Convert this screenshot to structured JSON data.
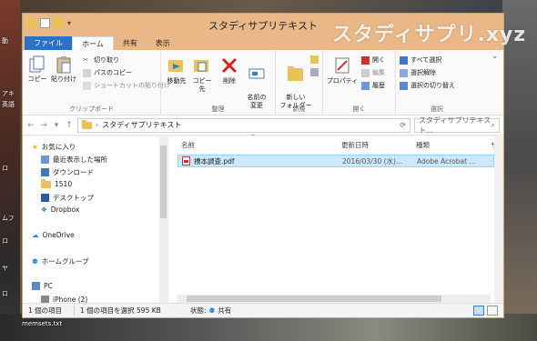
{
  "desktop": {
    "left_labels": [
      "動",
      "アキ",
      "英語",
      "ロ",
      "ムフ",
      "ロ",
      "ヤ",
      "ロ"
    ],
    "bottom_label": "memsets.txt"
  },
  "watermark": "スタディサプリ.xyz",
  "window": {
    "title": "スタディサプリテキスト"
  },
  "tabs": [
    {
      "label": "ファイル"
    },
    {
      "label": "ホーム"
    },
    {
      "label": "共有"
    },
    {
      "label": "表示"
    }
  ],
  "ribbon": {
    "clipboard": {
      "label": "クリップボード",
      "copy": "コピー",
      "paste": "貼り付け",
      "cut": "切り取り",
      "copy_path": "パスのコピー",
      "paste_shortcut": "ショートカットの貼り付け"
    },
    "organize": {
      "label": "整理",
      "move_to": "移動先",
      "copy_to": "コピー先",
      "delete": "削除",
      "rename": "名前の\n変更"
    },
    "new": {
      "label": "新規",
      "new_folder": "新しい\nフォルダー"
    },
    "open": {
      "label": "開く",
      "properties": "プロパティ",
      "open": "開く",
      "edit": "編集",
      "history": "履歴"
    },
    "select": {
      "label": "選択",
      "select_all": "すべて選択",
      "select_none": "選択解除",
      "invert": "選択の切り替え"
    }
  },
  "address": {
    "path": "スタディサプリテキスト",
    "search_placeholder": "スタディサプリテキスト..."
  },
  "nav_pane": {
    "favorites": "お気に入り",
    "items": [
      "最近表示した場所",
      "ダウンロード",
      "1510",
      "デスクトップ",
      "Dropbox"
    ],
    "onedrive": "OneDrive",
    "homegroup": "ホームグループ",
    "pc": "PC",
    "pc_child": "iPhone (2)"
  },
  "columns": {
    "name": "名前",
    "date": "更新日時",
    "type": "種類",
    "size": "サ"
  },
  "files": [
    {
      "name": "標本調査.pdf",
      "date": "2016/03/30 (水)...",
      "type": "Adobe Acrobat ..."
    }
  ],
  "status": {
    "count": "1 個の項目",
    "selected": "1 個の項目を選択  595 KB",
    "state_label": "状態:",
    "state_value": "共有"
  }
}
